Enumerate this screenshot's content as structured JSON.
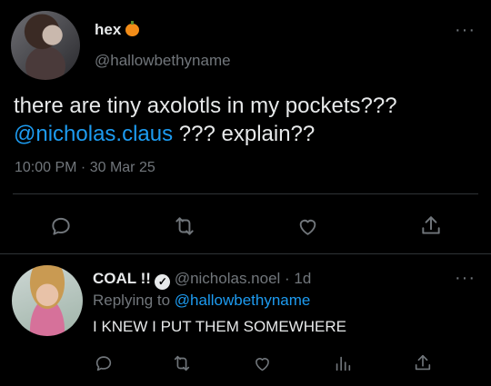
{
  "main_tweet": {
    "author_name": "hex",
    "author_handle": "@hallowbethyname",
    "more_icon": "more-dots-icon",
    "text_line1": "there are tiny axolotls in my pockets???",
    "text_mention": "@nicholas.claus",
    "text_rest": " ??? explain??",
    "timestamp": "10:00 PM · 30 Mar 25",
    "actions": [
      "reply-icon",
      "retweet-icon",
      "like-icon",
      "share-icon"
    ]
  },
  "reply_tweet": {
    "author_name": "COAL !!",
    "verified_icon": "verified-badge-icon",
    "author_handle": "@nicholas.noel · 1d",
    "replying_prefix": "Replying to ",
    "replying_to": "@hallowbethyname",
    "text": "I KNEW I PUT THEM SOMEWHERE",
    "actions": [
      "reply-icon",
      "retweet-icon",
      "like-icon",
      "views-icon",
      "share-icon"
    ]
  },
  "colors": {
    "background": "#000000",
    "text": "#e7e9ea",
    "secondary": "#71767b",
    "accent": "#1d9bf0",
    "divider": "#2f3336",
    "pumpkin": "#f28c18"
  }
}
